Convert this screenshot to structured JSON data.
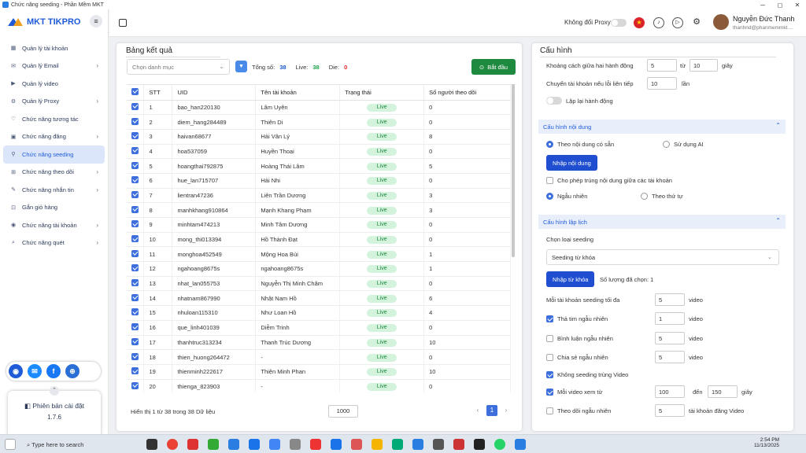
{
  "window": {
    "title": "Chức năng seeding - Phần Mềm MKT",
    "minimize": "─",
    "maximize": "◻",
    "close": "✕"
  },
  "logo": {
    "text": "MKT TIKPRO"
  },
  "sidebar": {
    "items": [
      {
        "label": "Quản lý tài khoản",
        "icon": "users-icon",
        "glyph": "▦",
        "chev": ""
      },
      {
        "label": "Quản lý Email",
        "icon": "email-icon",
        "glyph": "✉",
        "chev": "›"
      },
      {
        "label": "Quản lý video",
        "icon": "video-icon",
        "glyph": "▶",
        "chev": ""
      },
      {
        "label": "Quản lý Proxy",
        "icon": "proxy-icon",
        "glyph": "⚙",
        "chev": "›"
      },
      {
        "label": "Chức năng tương tác",
        "icon": "interact-icon",
        "glyph": "♡",
        "chev": ""
      },
      {
        "label": "Chức năng đăng",
        "icon": "post-icon",
        "glyph": "▣",
        "chev": "›"
      },
      {
        "label": "Chức năng seeding",
        "icon": "seeding-icon",
        "glyph": "⚲",
        "chev": ""
      },
      {
        "label": "Chức năng theo dõi",
        "icon": "follow-icon",
        "glyph": "⊞",
        "chev": "›"
      },
      {
        "label": "Chức năng nhắn tin",
        "icon": "message-icon",
        "glyph": "✎",
        "chev": "›"
      },
      {
        "label": "Gắn giỏ hàng",
        "icon": "cart-icon",
        "glyph": "⊡",
        "chev": ""
      },
      {
        "label": "Chức năng tài khoản",
        "icon": "account-icon",
        "glyph": "◉",
        "chev": "›"
      },
      {
        "label": "Chức năng quét",
        "icon": "scan-icon",
        "glyph": "⌕",
        "chev": "›"
      }
    ],
    "active_index": 6,
    "version_label": "Phiên bản cài đặt",
    "version_number": "1.7.6"
  },
  "topbar": {
    "proxy_label": "Không đổi Proxy",
    "user_name": "Nguyễn Đức Thanh",
    "user_email": "thanhnd@phanmemmkt...."
  },
  "results": {
    "title": "Bảng kết quả",
    "category_placeholder": "Chọn danh mục",
    "total_label": "Tổng số:",
    "total": "38",
    "live_label": "Live:",
    "live": "38",
    "die_label": "Die:",
    "die": "0",
    "start_label": "Bắt đầu",
    "columns": [
      "STT",
      "UID",
      "Tên tài khoản",
      "Trạng thái",
      "Số người theo dõi"
    ],
    "rows": [
      [
        "1",
        "bao_han220130",
        "Lâm Uyên",
        "Live",
        "0"
      ],
      [
        "2",
        "diem_hang284489",
        "Thiên Di",
        "Live",
        "0"
      ],
      [
        "3",
        "haivan68677",
        "Hải Vân Lý",
        "Live",
        "8"
      ],
      [
        "4",
        "hoa537059",
        "Huyền Thoại",
        "Live",
        "0"
      ],
      [
        "5",
        "hoangthai792875",
        "Hoàng Thái Lâm",
        "Live",
        "5"
      ],
      [
        "6",
        "hue_lan715707",
        "Hải Nhi",
        "Live",
        "0"
      ],
      [
        "7",
        "lientran47236",
        "Liên Trần Dương",
        "Live",
        "3"
      ],
      [
        "8",
        "manhkhang910864",
        "Mạnh Khang Phạm",
        "Live",
        "3"
      ],
      [
        "9",
        "minhtam474213",
        "Minh Tâm Dương",
        "Live",
        "0"
      ],
      [
        "10",
        "mong_thi013394",
        "Hồ Thành Đạt",
        "Live",
        "0"
      ],
      [
        "11",
        "monghoa452549",
        "Mộng Hoa Bùi",
        "Live",
        "1"
      ],
      [
        "12",
        "ngahoang8675s",
        "ngahoang8675s",
        "Live",
        "1"
      ],
      [
        "13",
        "nhat_lan055753",
        "Nguyễn Thị Minh Châm",
        "Live",
        "0"
      ],
      [
        "14",
        "nhatnam867990",
        "Nhật Nam Hồ",
        "Live",
        "6"
      ],
      [
        "15",
        "nhuloan115310",
        "Như Loan Hồ",
        "Live",
        "4"
      ],
      [
        "16",
        "que_linh401039",
        "Diễm Trinh",
        "Live",
        "0"
      ],
      [
        "17",
        "thanhtruc313234",
        "Thanh Trúc Dương",
        "Live",
        "10"
      ],
      [
        "18",
        "thien_huong264472",
        "-",
        "Live",
        "0"
      ],
      [
        "19",
        "thienminh222617",
        "Thiện Minh Phan",
        "Live",
        "10"
      ],
      [
        "20",
        "thienga_823903",
        "-",
        "Live",
        "0"
      ]
    ],
    "footer": "Hiển thị 1 từ 38 trong 38 Dữ liệu",
    "page_size": "1000",
    "current_page": "1",
    "prev": "‹",
    "next": "›"
  },
  "config": {
    "title": "Cấu hình",
    "delay_label": "Khoảng cách giữa hai hành động",
    "delay_from": "5",
    "delay_to_label": "từ",
    "delay_to": "10",
    "delay_unit": "giây",
    "switch_label": "Chuyển tài khoản nếu lỗi liên tiếp",
    "switch_value": "10",
    "switch_unit": "lần",
    "repeat_label": "Lặp lại hành động",
    "content_head": "Cấu hình nội dung",
    "content_opt1": "Theo nội dung có sẵn",
    "content_opt2": "Sử dụng AI",
    "input_content_btn": "Nhập nội dung",
    "allow_dup": "Cho phép trùng nội dung giữa các tài khoản",
    "random": "Ngẫu nhiên",
    "sequential": "Theo thứ tự",
    "schedule_head": "Cấu hình lập lịch",
    "seeding_type_label": "Chọn loại seeding",
    "seeding_type": "Seeding từ khóa",
    "keyword_btn": "Nhập từ khóa",
    "selected_count": "Số lượng đã chọn: 1",
    "max_label": "Mỗi tài khoản seeding tối đa",
    "max_value": "5",
    "max_unit": "video",
    "heart_label": "Thả tim ngẫu nhiên",
    "heart_value": "1",
    "heart_unit": "video",
    "comment_label": "Bình luận ngẫu nhiên",
    "comment_value": "5",
    "comment_unit": "video",
    "share_label": "Chia sẻ ngẫu nhiên",
    "share_value": "5",
    "share_unit": "video",
    "nodup_label": "Không seeding trùng Video",
    "watch_label": "Mỗi video xem từ",
    "watch_from": "100",
    "watch_to_label": "đến",
    "watch_to": "150",
    "watch_unit": "giây",
    "follow_label": "Theo dõi ngẫu nhiên",
    "follow_value": "5",
    "follow_unit": "tài khoản đăng Video"
  },
  "taskbar": {
    "search": "Type here to search",
    "time": "2:54 PM",
    "date": "11/13/2025"
  },
  "colors": {
    "accent": "#1f5bd8",
    "live_bg": "#d3f3dc",
    "start": "#1e8a3f"
  }
}
